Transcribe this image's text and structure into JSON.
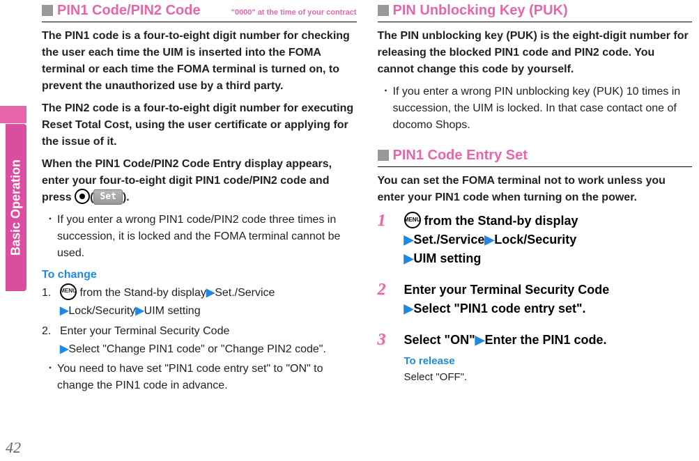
{
  "sidebar": {
    "label": "Basic Operation",
    "page_number": "42"
  },
  "left": {
    "section1": {
      "title": "PIN1 Code/PIN2 Code",
      "note": "\"0000\" at the time of your contract",
      "para1": "The PIN1 code is a four-to-eight digit number for checking the user each time the UIM is inserted into the FOMA terminal or each time the FOMA terminal is turned on, to prevent the unauthorized use by a third party.",
      "para2": "The PIN2 code is a four-to-eight digit number for executing Reset Total Cost, using the user certificate or applying for the issue of it.",
      "para3_a": "When the PIN1 Code/PIN2 Code Entry display appears, enter your four-to-eight digit PIN1 code/PIN2 code and press ",
      "set_label": "Set",
      "para3_b": ").",
      "bullet1": "If you enter a wrong PIN1 code/PIN2 code three times in succession, it is locked and the FOMA terminal cannot be used.",
      "to_change": "To change",
      "menu_icon": "MENU",
      "step1_a": " from the Stand-by display",
      "step1_b": "Set./Service",
      "step1_c": "Lock/Security",
      "step1_d": "UIM setting",
      "step2_a": "Enter your Terminal Security Code",
      "step2_b": "Select \"Change PIN1 code\" or \"Change PIN2 code\".",
      "bullet2": "You need to have set \"PIN1 code entry set\" to \"ON\" to change the PIN1 code in advance."
    }
  },
  "right": {
    "section1": {
      "title": "PIN Unblocking Key (PUK)",
      "para1": "The PIN unblocking key (PUK) is the eight-digit number for releasing the blocked PIN1 code and PIN2 code. You cannot change this code by yourself.",
      "bullet1": "If you enter a wrong PIN unblocking key (PUK) 10 times in succession, the UIM is locked. In that case contact one of docomo Shops."
    },
    "section2": {
      "title": "PIN1 Code Entry Set",
      "para1": "You can set the FOMA terminal not to work unless you enter your PIN1 code when turning on the power.",
      "menu_icon": "MENU",
      "step1_a": " from the Stand-by display",
      "step1_b": "Set./Service",
      "step1_c": "Lock/Security",
      "step1_d": "UIM setting",
      "step2_a": "Enter your Terminal Security Code",
      "step2_b": "Select \"PIN1 code entry set\".",
      "step3_a": "Select \"ON\"",
      "step3_b": "Enter the PIN1 code.",
      "to_release": "To release",
      "release_text": "Select \"OFF\"."
    }
  }
}
